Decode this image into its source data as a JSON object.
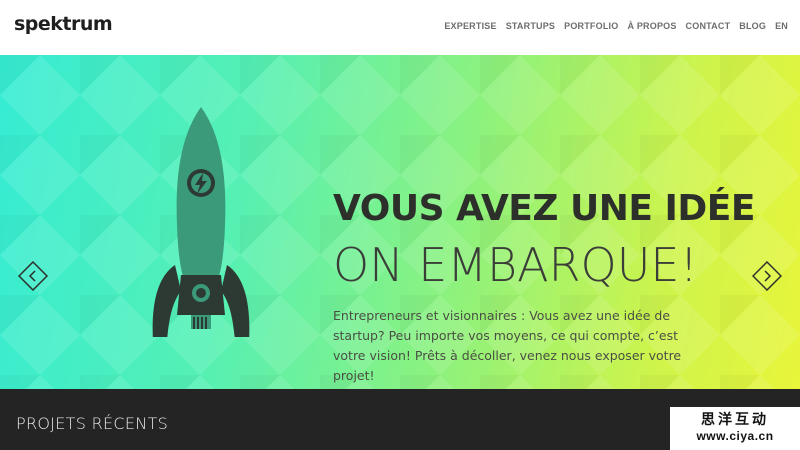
{
  "brand": {
    "logo": "spektrum"
  },
  "nav": {
    "items": [
      {
        "label": "EXPERTISE"
      },
      {
        "label": "STARTUPS"
      },
      {
        "label": "PORTFOLIO"
      },
      {
        "label": "À PROPOS"
      },
      {
        "label": "CONTACT"
      },
      {
        "label": "BLOG"
      },
      {
        "label": "EN"
      }
    ]
  },
  "hero": {
    "headline": "VOUS AVEZ UNE IDÉE",
    "subheadline": "ON EMBARQUE!",
    "description": "Entrepreneurs et visionnaires : Vous avez une idée de startup? Peu importe vos moyens, ce qui compte, c’est votre vision! Prêts à décoller, venez nous exposer votre projet!",
    "icons": {
      "illustration": "rocket-icon",
      "prev": "chevron-left-icon",
      "next": "chevron-right-icon"
    }
  },
  "recent": {
    "title": "PROJETS RÉCENTS"
  },
  "watermark": {
    "line1": "思洋互动",
    "line2": "www.ciya.cn"
  },
  "colors": {
    "gradient_start": "#35ecd4",
    "gradient_end": "#e8f53a",
    "rocket_body": "#3a9a7a",
    "rocket_dark": "#2d3a33",
    "text_dark": "#2d2f2b",
    "bottom_bar": "#242424"
  }
}
